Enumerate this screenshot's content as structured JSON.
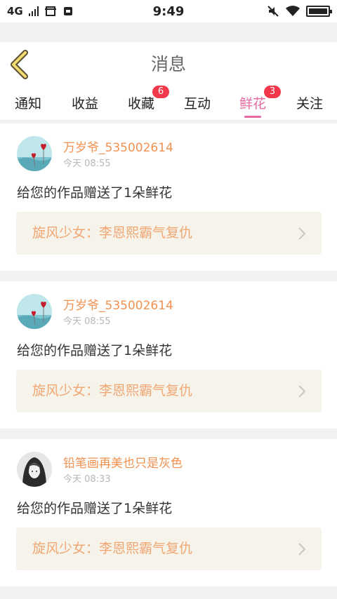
{
  "status_bar": {
    "network": "4G",
    "time": "9:49"
  },
  "header": {
    "title": "消息"
  },
  "tabs": [
    {
      "label": "通知"
    },
    {
      "label": "收益"
    },
    {
      "label": "收藏",
      "badge": "6"
    },
    {
      "label": "互动"
    },
    {
      "label": "鲜花",
      "badge": "3",
      "active": true
    },
    {
      "label": "关注"
    }
  ],
  "colors": {
    "accent": "#e66aa1",
    "username": "#f0914f",
    "badge": "#f0384a",
    "work_title": "#f0a774"
  },
  "messages": [
    {
      "username": "万岁爷_535002614",
      "time": "今天 08:55",
      "text": "给您的作品赠送了1朵鲜花",
      "work_title": "旋风少女：李恩熙霸气复仇",
      "avatar_icon": "hearts-avatar-icon"
    },
    {
      "username": "万岁爷_535002614",
      "time": "今天 08:55",
      "text": "给您的作品赠送了1朵鲜花",
      "work_title": "旋风少女：李恩熙霸气复仇",
      "avatar_icon": "hearts-avatar-icon"
    },
    {
      "username": "铅笔画再美也只是灰色",
      "time": "今天 08:33",
      "text": "给您的作品赠送了1朵鲜花",
      "work_title": "旋风少女：李恩熙霸气复仇",
      "avatar_icon": "hooded-figure-avatar-icon"
    }
  ]
}
